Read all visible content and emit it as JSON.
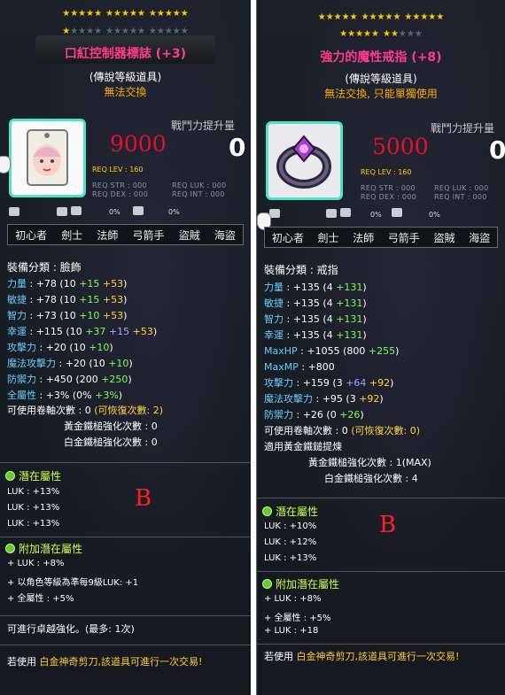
{
  "left": {
    "star_rows": [
      5,
      5,
      5
    ],
    "star_row2_filled": 1,
    "star_row2_total": 15,
    "title": "口紅控制器標誌 (+3)",
    "grade": "(傳說等級道具)",
    "trade": "無法交換",
    "cp_label": "戰鬥力提升量",
    "value": "9000",
    "cp_value": "0",
    "req_lev": "REQ LEV : 160",
    "req_str": "REQ STR : 000",
    "req_dex": "REQ DEX : 000",
    "req_luk": "REQ LUK : 000",
    "req_int": "REQ INT : 000",
    "pct1": "0%",
    "pct2": "0%",
    "jobs": [
      "初心者",
      "劍士",
      "法師",
      "弓箭手",
      "盜賊",
      "海盜"
    ],
    "category": "裝備分類 : 臉飾",
    "stats": [
      {
        "name": "力量",
        "base": " : +78 (10 ",
        "a": "+15",
        "b": " +53",
        ")": ")"
      },
      {
        "name": "敏捷",
        "base": " : +78 (10 ",
        "a": "+15",
        "b": " +53",
        ")": ")"
      },
      {
        "name": "智力",
        "base": " : +73 (10 ",
        "a": "+10",
        "b": " +53",
        ")": ")"
      },
      {
        "name": "幸運",
        "base": " : +115 (10 ",
        "a": "+37",
        "c": " +15",
        "b": " +53",
        ")": ")"
      },
      {
        "name": "攻擊力",
        "base": " : +20 (10 ",
        "a": "+10",
        ")": ")"
      },
      {
        "name": "魔法攻擊力",
        "base": " : +20 (10 ",
        "a": "+10",
        ")": ")"
      },
      {
        "name": "防禦力",
        "base": " : +450 (200 ",
        "a": "+250",
        ")": ")"
      },
      {
        "name": "全屬性",
        "base": " : +3% (0% ",
        "a": "+3%",
        ")": ")"
      }
    ],
    "scroll": "可使用卷軸次數 : 0 ",
    "scroll_recover": "(可恢復次數: 2)",
    "hammer_gold": "黃金鐵槌強化次數 : 0",
    "hammer_white": "白金鐵槌強化次數 : 0",
    "potential_title": "潛在屬性",
    "potential": [
      "LUK : +13%",
      "LUK : +13%",
      "LUK : +13%"
    ],
    "bonus_title": "附加潛在屬性",
    "bonus": [
      "+ LUK : +8%",
      "+ 以角色等級為準每9級LUK: +1",
      "+ 全屬性 : +5%"
    ],
    "star_force": "可進行卓越強化。(最多: 1次)",
    "scissors_prefix": "若使用 ",
    "scissors_name": "白金神奇剪刀,該道具可進行一次交易!",
    "b_mark": "B"
  },
  "right": {
    "star_rows": [
      5,
      5,
      5
    ],
    "star_row2_filled": 7,
    "star_row2_total": 10,
    "title": "強力的魔性戒指 (+8)",
    "grade": "(傳說等級道具)",
    "trade": "無法交換, 只能單獨使用",
    "cp_label": "戰鬥力提升量",
    "value": "5000",
    "cp_value": "0",
    "req_lev": "REQ LEV : 160",
    "req_str": "REQ STR : 000",
    "req_dex": "REQ DEX : 000",
    "req_luk": "REQ LUK : 000",
    "req_int": "REQ INT : 000",
    "pct1": "0%",
    "pct2": "0%",
    "jobs": [
      "初心者",
      "劍士",
      "法師",
      "弓箭手",
      "盜賊",
      "海盜"
    ],
    "category": "裝備分類 : 戒指",
    "stats": [
      {
        "name": "力量",
        "base": " : +135 (4 ",
        "a": "+131",
        ")": ")"
      },
      {
        "name": "敏捷",
        "base": " : +135 (4 ",
        "a": "+131",
        ")": ")"
      },
      {
        "name": "智力",
        "base": " : +135 (4 ",
        "a": "+131",
        ")": ")"
      },
      {
        "name": "幸運",
        "base": " : +135 (4 ",
        "a": "+131",
        ")": ")"
      },
      {
        "name": "MaxHP",
        "base": " : +1055 (800 ",
        "a": "+255",
        ")": ")"
      },
      {
        "name": "MaxMP",
        "base": " : +800",
        ")": ""
      },
      {
        "name": "攻擊力",
        "base": " : +159 (3 ",
        "c": "+64",
        "b": " +92",
        ")": ")"
      },
      {
        "name": "魔法攻擊力",
        "base": " : +95 (3 ",
        "b": "+92",
        ")": ")"
      },
      {
        "name": "防禦力",
        "base": " : +26 (0 ",
        "a": "+26",
        ")": ")"
      }
    ],
    "scroll": "可使用卷軸次數 : 0 ",
    "scroll_recover": "(可恢復次數: 0)",
    "golden_hammer": "適用黃金鐵鎚提煉",
    "hammer_gold": "黃金鐵槌強化次數 : 1(MAX)",
    "hammer_white": "白金鐵槌強化次數 : 4",
    "potential_title": "潛在屬性",
    "potential": [
      "LUK : +10%",
      "LUK : +12%",
      "LUK : +13%"
    ],
    "bonus_title": "附加潛在屬性",
    "bonus": [
      "+ LUK : +8%",
      "+ 全屬性 : +5%",
      "+ LUK : +18"
    ],
    "scissors_prefix": "若使用 ",
    "scissors_name": "白金神奇剪刀,該道具可進行一次交易!",
    "b_mark": "B"
  },
  "colors": {
    "title": "#ff3c8c",
    "power": "#e8102a",
    "stat_green": "#7dff5a",
    "stat_cyan": "#66ccff",
    "stat_yellow": "#ffd83c",
    "frame": "#4ce4c8",
    "b_mark": "#ff2020"
  }
}
